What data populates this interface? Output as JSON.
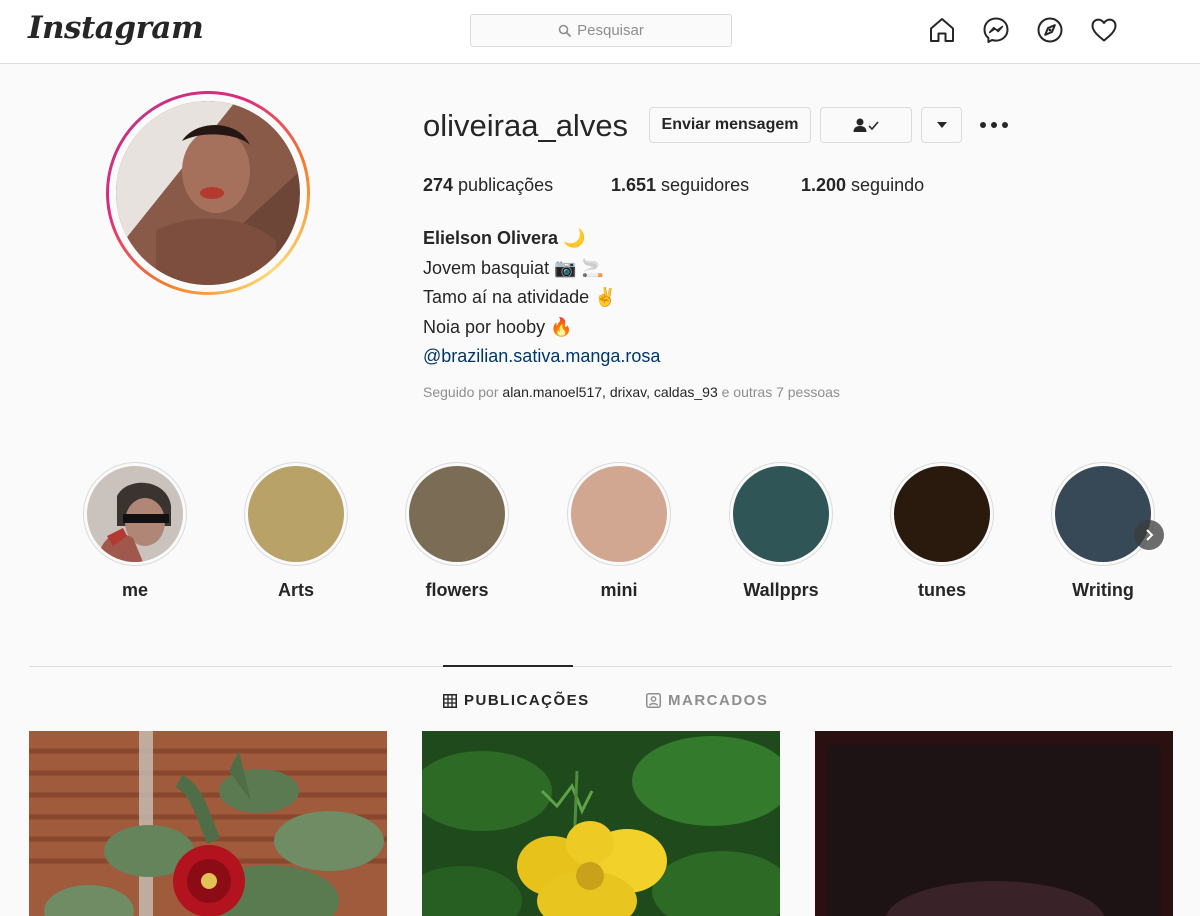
{
  "nav": {
    "logo": "Instagram",
    "search_placeholder": "Pesquisar",
    "icons": [
      "home-icon",
      "messenger-icon",
      "explore-icon",
      "heart-icon"
    ]
  },
  "profile": {
    "username": "oliveiraa_alves",
    "message_button": "Enviar mensagem",
    "stats": {
      "posts_count": "274",
      "posts_label": " publicações",
      "followers_count": "1.651",
      "followers_label": " seguidores",
      "following_count": "1.200",
      "following_label": " seguindo"
    },
    "bio": {
      "name": "Elielson Olivera 🌙",
      "line1": "Jovem basquiat 📷 🚬",
      "line2": "Tamo aí na atividade ✌️",
      "line3": "Noia por hooby 🔥",
      "link": "@brazilian.sativa.manga.rosa"
    },
    "followed_by": {
      "prefix": "Seguido por ",
      "users": "alan.manoel517, drixav, caldas_93",
      "suffix": " e outras 7 pessoas"
    }
  },
  "highlights": [
    {
      "label": "me",
      "color": "#c9c2bd"
    },
    {
      "label": "Arts",
      "color": "#b9a267"
    },
    {
      "label": "flowers",
      "color": "#7b6d55"
    },
    {
      "label": "mini",
      "color": "#d1a791"
    },
    {
      "label": "Wallpprs",
      "color": "#2f5556"
    },
    {
      "label": "tunes",
      "color": "#2a1a0d"
    },
    {
      "label": "Writing",
      "color": "#374856"
    }
  ],
  "tabs": {
    "posts": "PUBLICAÇÕES",
    "tagged": "MARCADOS"
  },
  "colors": {
    "link": "#00376b",
    "border": "#dbdbdb",
    "muted": "#8e8e8e",
    "text": "#262626"
  }
}
